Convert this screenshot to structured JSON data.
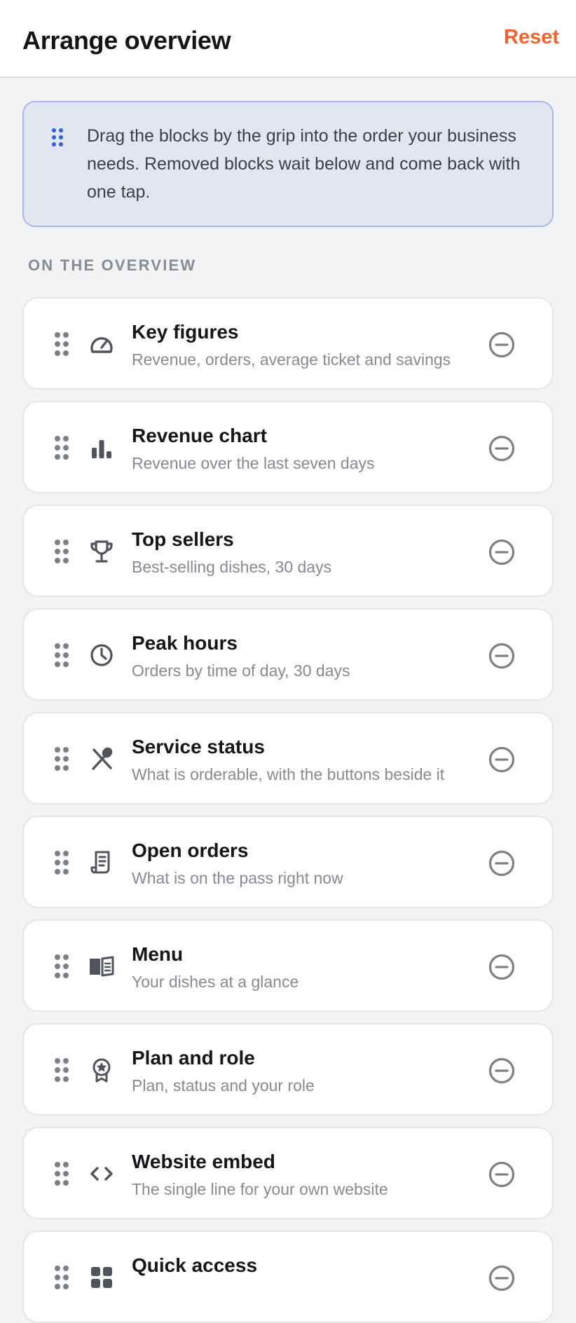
{
  "header": {
    "title": "Arrange overview",
    "reset_label": "Reset",
    "accent_color": "#f2622a"
  },
  "info": {
    "icon": "grip-dots-icon",
    "text": "Drag the blocks by the grip into the order your business needs. Removed blocks wait below and come back with one tap."
  },
  "section": {
    "label": "ON THE OVERVIEW"
  },
  "blocks": [
    {
      "id": "key-figures",
      "title": "Key figures",
      "subtitle": "Revenue, orders, average ticket and savings",
      "icon": "gauge-icon"
    },
    {
      "id": "revenue-chart",
      "title": "Revenue chart",
      "subtitle": "Revenue over the last seven days",
      "icon": "bar-chart-icon"
    },
    {
      "id": "top-sellers",
      "title": "Top sellers",
      "subtitle": "Best-selling dishes, 30 days",
      "icon": "trophy-icon"
    },
    {
      "id": "peak-hours",
      "title": "Peak hours",
      "subtitle": "Orders by time of day, 30 days",
      "icon": "clock-icon"
    },
    {
      "id": "service-status",
      "title": "Service status",
      "subtitle": "What is orderable, with the buttons beside it",
      "icon": "utensils-icon"
    },
    {
      "id": "open-orders",
      "title": "Open orders",
      "subtitle": "What is on the pass right now",
      "icon": "receipt-icon"
    },
    {
      "id": "menu",
      "title": "Menu",
      "subtitle": "Your dishes at a glance",
      "icon": "book-open-icon"
    },
    {
      "id": "plan-and-role",
      "title": "Plan and role",
      "subtitle": "Plan, status and your role",
      "icon": "award-badge-icon"
    },
    {
      "id": "website-embed",
      "title": "Website embed",
      "subtitle": "The single line for your own website",
      "icon": "code-icon"
    },
    {
      "id": "quick-access",
      "title": "Quick access",
      "subtitle": "",
      "icon": "grid-icon"
    }
  ]
}
